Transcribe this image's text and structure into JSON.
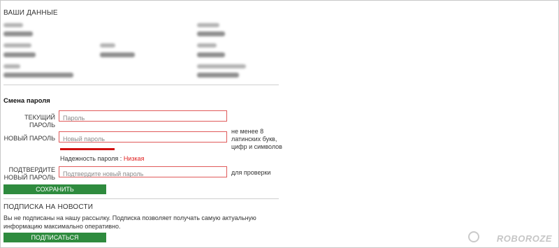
{
  "personal": {
    "title": "ВАШИ ДАННЫЕ"
  },
  "password_change": {
    "title": "Смена пароля",
    "current": {
      "label": "ТЕКУЩИЙ ПАРОЛЬ",
      "placeholder": "Пароль"
    },
    "new": {
      "label": "НОВЫЙ ПАРОЛЬ",
      "placeholder": "Новый пароль",
      "hint_lines": [
        "не менее 8",
        "латинских букв,",
        "цифр и символов"
      ]
    },
    "strength": {
      "label": "Надежность пароля :",
      "value": "Низкая"
    },
    "confirm": {
      "label_lines": [
        "ПОДТВЕРДИТЕ",
        "НОВЫЙ ПАРОЛЬ"
      ],
      "placeholder": "Подтвердите новый пароль",
      "hint": "для проверки"
    },
    "save_label": "СОХРАНИТЬ"
  },
  "newsletter": {
    "title": "ПОДПИСКА НА НОВОСТИ",
    "text_lines": [
      "Вы не подписаны на нашу рассылку. Подписка позволяет получать самую актуальную",
      "информацию максимально оперативно."
    ],
    "subscribe_label": "ПОДПИСАТЬСЯ"
  },
  "watermark": {
    "text": "ROBOROZE"
  },
  "colors": {
    "accent": "#2e8b3e",
    "error_border": "#e05a5a",
    "strength_low": "#d10f0f"
  }
}
